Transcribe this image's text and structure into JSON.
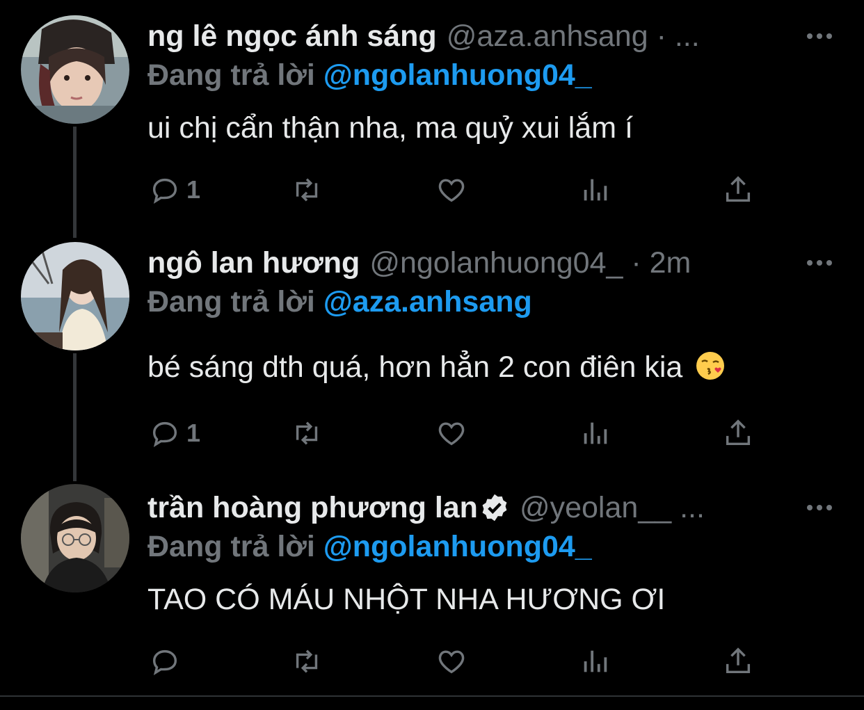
{
  "tweets": [
    {
      "name": "ng lê ngọc ánh sáng",
      "handle_meta": "@aza.anhsang · ...",
      "reply_prefix": "Đang trả lời",
      "reply_to": "@ngolanhuong04_",
      "text": "ui chị cẩn thận nha, ma quỷ xui lắm í",
      "reply_count": "1",
      "verified": false
    },
    {
      "name": "ngô lan hương",
      "handle_meta": "@ngolanhuong04_ · 2m",
      "reply_prefix": "Đang trả lời",
      "reply_to": "@aza.anhsang",
      "text": "bé sáng dth quá, hơn hẳn 2 con điên kia",
      "reply_count": "1",
      "verified": false,
      "emoji": "face-blowing-kiss-icon"
    },
    {
      "name": "trần hoàng phương lan",
      "handle_meta": "@yeolan__ ...",
      "reply_prefix": "Đang trả lời",
      "reply_to": "@ngolanhuong04_",
      "text": "TAO CÓ MÁU NHỘT NHA HƯƠNG ƠI",
      "reply_count": "",
      "verified": true
    }
  ],
  "colors": {
    "background": "#000000",
    "primary_text": "#e7e9ea",
    "secondary_text": "#71767b",
    "mention": "#1d9bf0",
    "thread_line": "#333639"
  },
  "icons": [
    "reply-icon",
    "retweet-icon",
    "like-icon",
    "views-icon",
    "share-icon",
    "more-icon",
    "verified-icon"
  ]
}
